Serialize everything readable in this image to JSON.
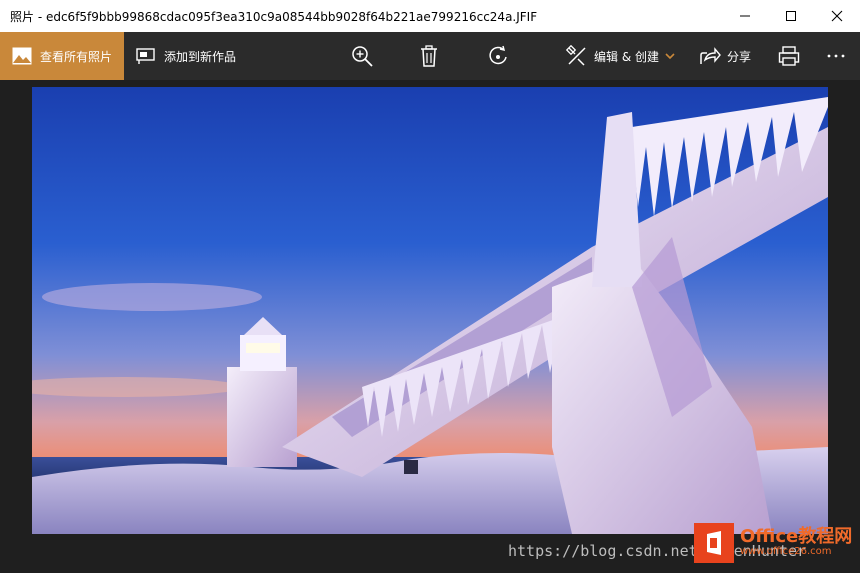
{
  "window": {
    "title": "照片 - edc6f5f9bbb99868cdac095f3ea310c9a08544bb9028f64b221ae799216cc24a.JFIF"
  },
  "toolbar": {
    "view_all_label": "查看所有照片",
    "add_to_creation_label": "添加到新作品",
    "edit_create_label": "编辑 & 创建",
    "share_label": "分享"
  },
  "watermark": {
    "text": "https://blog.csdn.net/SevenHunter"
  },
  "logo": {
    "brand": "Office教程网",
    "url": "www.office26.com"
  },
  "icons": {
    "view_all": "landscape-photo-icon",
    "add": "add-to-creation-icon",
    "zoom": "zoom-in-icon",
    "delete": "trash-icon",
    "rotate": "rotate-icon",
    "edit": "edit-create-icon",
    "chevron": "chevron-down-icon",
    "share": "share-icon",
    "print": "print-icon",
    "more": "more-icon"
  },
  "colors": {
    "accent": "#c9883a",
    "toolbar_bg": "#2b2b2b",
    "window_bg": "#1f1f1f"
  }
}
